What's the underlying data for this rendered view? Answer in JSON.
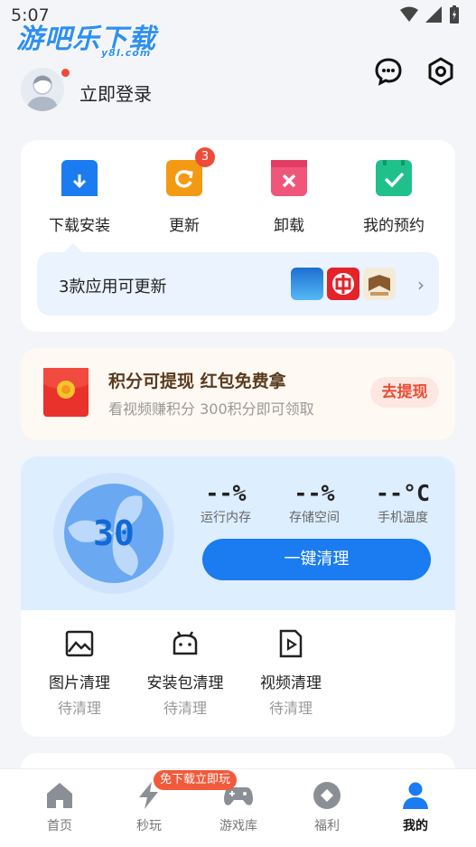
{
  "status_bar": {
    "time": "5:07"
  },
  "watermark": {
    "main": "游吧乐下载",
    "sub": "y8l.com"
  },
  "header": {
    "login_label": "立即登录",
    "icons": [
      "chat-icon",
      "settings-icon"
    ]
  },
  "quick_actions": {
    "items": [
      {
        "label": "下载安装",
        "icon": "download-icon",
        "color": "#1a7cf0"
      },
      {
        "label": "更新",
        "icon": "update-icon",
        "color": "#f39a12",
        "badge": "3"
      },
      {
        "label": "卸载",
        "icon": "uninstall-icon",
        "color": "#f0557a"
      },
      {
        "label": "我的预约",
        "icon": "reservation-icon",
        "color": "#20c08a"
      }
    ],
    "update_bar": {
      "text": "3款应用可更新",
      "apps": [
        "app-thumb-1",
        "app-thumb-2",
        "app-thumb-3"
      ]
    }
  },
  "reward": {
    "title": "积分可提现 红包免费拿",
    "subtitle": "看视频赚积分 300积分即可领取",
    "button": "去提现"
  },
  "cleaner": {
    "score": "30",
    "stats": [
      {
        "value": "--%",
        "label": "运行内存"
      },
      {
        "value": "--%",
        "label": "存储空间"
      },
      {
        "value": "--°C",
        "label": "手机温度"
      }
    ],
    "clean_button": "一键清理",
    "items": [
      {
        "label": "图片清理",
        "status": "待清理",
        "icon": "image-icon"
      },
      {
        "label": "安装包清理",
        "status": "待清理",
        "icon": "android-icon"
      },
      {
        "label": "视频清理",
        "status": "待清理",
        "icon": "video-icon"
      }
    ]
  },
  "tabbar": {
    "promo": "免下载立即玩",
    "tabs": [
      {
        "label": "首页",
        "icon": "home-icon"
      },
      {
        "label": "秒玩",
        "icon": "lightning-icon"
      },
      {
        "label": "游戏库",
        "icon": "gamepad-icon"
      },
      {
        "label": "福利",
        "icon": "gift-icon"
      },
      {
        "label": "我的",
        "icon": "user-icon",
        "active": true
      }
    ]
  },
  "colors": {
    "accent": "#1a7cf0",
    "danger": "#ee4b3a"
  }
}
